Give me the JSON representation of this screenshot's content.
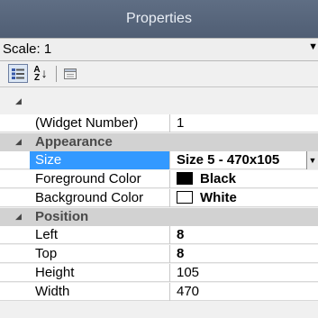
{
  "panel": {
    "title": "Properties",
    "scale_label": "Scale: 1"
  },
  "toolbar": {
    "categorized_icon": "categorized-icon",
    "alphabetical_icon": "sort-az-icon",
    "property_pages_icon": "property-pages-icon",
    "alphabetical_glyph_top": "A",
    "alphabetical_glyph_bottom": "Z"
  },
  "misc": {
    "widget_number_name": "(Widget Number)",
    "widget_number_value": "1"
  },
  "appearance": {
    "label": "Appearance",
    "size_name": "Size",
    "size_value": "Size 5 - 470x105",
    "foreground_name": "Foreground Color",
    "foreground_value": "Black",
    "foreground_color": "#000000",
    "background_name": "Background Color",
    "background_value": "White",
    "background_color": "#ffffff"
  },
  "position": {
    "label": "Position",
    "left_name": "Left",
    "left_value": "8",
    "top_name": "Top",
    "top_value": "8",
    "height_name": "Height",
    "height_value": "105",
    "width_name": "Width",
    "width_value": "470"
  }
}
